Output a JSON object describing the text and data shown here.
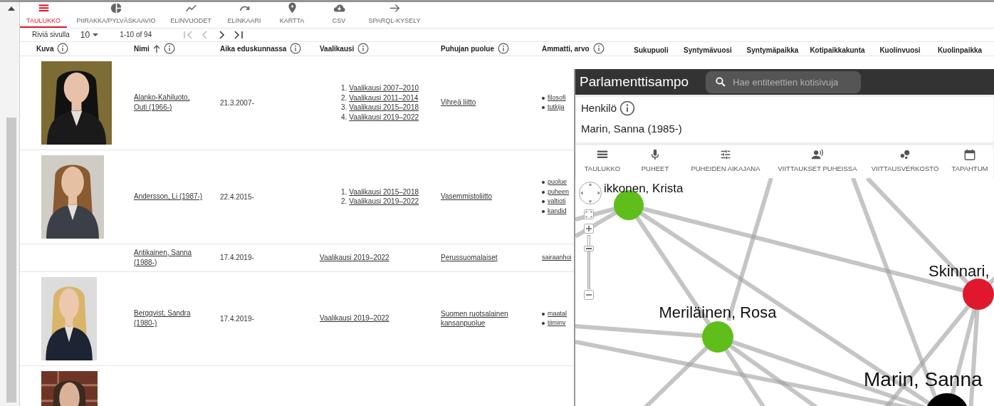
{
  "main_tabs": [
    {
      "label": "TAULUKKO",
      "selected": true
    },
    {
      "label": "PIIRAKKA/PYLVÄSKAAVIO",
      "selected": false
    },
    {
      "label": "ELINVUODET",
      "selected": false
    },
    {
      "label": "ELINKAARI",
      "selected": false
    },
    {
      "label": "KARTTA",
      "selected": false
    },
    {
      "label": "CSV",
      "selected": false
    },
    {
      "label": "SPARQL-KYSELY",
      "selected": false
    }
  ],
  "pagination": {
    "rows_per_page_label": "Riviä sivulla",
    "rows_per_page": "10",
    "range": "1-10 of 94"
  },
  "table": {
    "columns": [
      {
        "label": "Kuva",
        "info": true,
        "sorted": false
      },
      {
        "label": "Nimi",
        "info": true,
        "sorted": true
      },
      {
        "label": "Aika eduskunnassa",
        "info": true,
        "sorted": false
      },
      {
        "label": "Vaalikausi",
        "info": true,
        "sorted": false
      },
      {
        "label": "Puhujan puolue",
        "info": true,
        "sorted": false
      },
      {
        "label": "Ammatti, arvo",
        "info": true,
        "sorted": false
      },
      {
        "label": "Sukupuoli",
        "info": false,
        "sorted": false
      },
      {
        "label": "Syntymävuosi",
        "info": false,
        "sorted": false
      },
      {
        "label": "Syntymäpaikka",
        "info": false,
        "sorted": false
      },
      {
        "label": "Kotipaikkakunta",
        "info": false,
        "sorted": false
      },
      {
        "label": "Kuolinvuosi",
        "info": false,
        "sorted": false
      },
      {
        "label": "Kuolinpaikka",
        "info": false,
        "sorted": false
      }
    ],
    "rows": [
      {
        "photo": {
          "kind": "picture"
        },
        "name": "Alanko-Kahiluoto, Outi (1966-)",
        "time": "21.3.2007-",
        "terms": [
          {
            "number": "1.",
            "label": "Vaalikausi 2007–2010"
          },
          {
            "number": "2.",
            "label": "Vaalikausi 2011–2014"
          },
          {
            "number": "3.",
            "label": "Vaalikausi 2015–2018"
          },
          {
            "number": "4.",
            "label": "Vaalikausi 2019–2022"
          }
        ],
        "party": "Vihreä liitto",
        "occupations": [
          "filosofi",
          "tutkija"
        ]
      },
      {
        "photo": {
          "kind": "picture"
        },
        "name": "Andersson, Li (1987-)",
        "time": "22.4.2015-",
        "terms": [
          {
            "number": "1.",
            "label": "Vaalikausi 2015–2018"
          },
          {
            "number": "2.",
            "label": "Vaalikausi 2019–2022"
          }
        ],
        "party": "Vasemmistoliitto",
        "occupations": [
          "puolue",
          "puheen",
          "valtioti",
          "kandid"
        ]
      },
      {
        "name": "Antikainen, Sanna (1988-)",
        "time": "17.4.2019-",
        "terms": [
          {
            "label": "Vaalikausi 2019–2022"
          }
        ],
        "party": "Perussuomalaiset",
        "occupations": [
          "sairaanhoi"
        ]
      },
      {
        "photo": {
          "kind": "picture"
        },
        "name": "Bergqvist, Sandra (1980-)",
        "time": "17.4.2019-",
        "terms": [
          {
            "label": "Vaalikausi 2019–2022"
          }
        ],
        "party": "Suomen ruotsalainen kansanpuolue",
        "occupations": [
          "maatal",
          "tiiminv"
        ]
      },
      {
        "photo": {
          "kind": "picture"
        }
      }
    ]
  },
  "overlay": {
    "app_title": "Parlamenttisampo",
    "search_placeholder": "Hae entiteettien kotisivuja",
    "entity_type": "Henkilö",
    "entity_name": "Marin, Sanna (1985-)",
    "tabs": [
      {
        "label": "TAULUKKO",
        "selected": false
      },
      {
        "label": "PUHEET",
        "selected": false
      },
      {
        "label": "PUHEIDEN AIKAJANA",
        "selected": false
      },
      {
        "label": "VIITTAUKSET PUHEISSA",
        "selected": false
      },
      {
        "label": "VIITTAUSVERKOSTO",
        "selected": false
      },
      {
        "label": "TAPAHTUM",
        "selected": false
      }
    ],
    "network": {
      "zoom": {
        "level": 0.75
      },
      "nodes": [
        {
          "label": "ikkonen, Krista",
          "color": "#5fbe1a"
        },
        {
          "label": "Meriläinen, Rosa",
          "color": "#5fbe1a"
        },
        {
          "label": "Skinnari,",
          "color": "#e0182d"
        },
        {
          "label": "Marin, Sanna",
          "color": "#000000"
        }
      ]
    }
  }
}
